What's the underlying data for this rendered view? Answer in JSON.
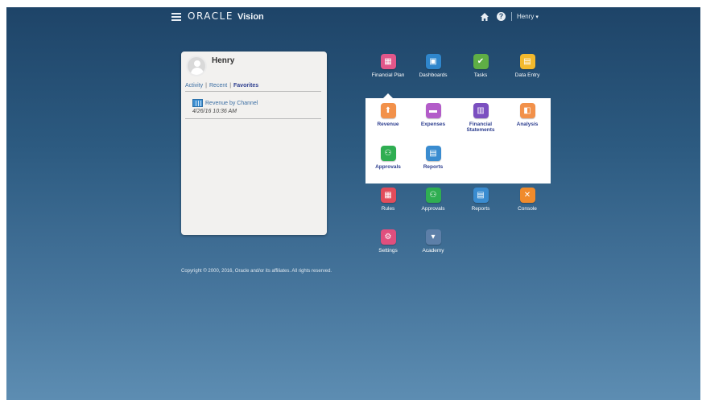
{
  "app": {
    "logo_oracle": "ORACLE",
    "logo_vision": "Vision",
    "user_menu_label": "Henry",
    "user_menu_caret": "▾",
    "help_glyph": "?"
  },
  "profile": {
    "name": "Henry",
    "tabs": [
      {
        "label": "Activity"
      },
      {
        "label": "Recent"
      },
      {
        "label": "Favorites"
      }
    ],
    "tab_separator": "|",
    "favorite": {
      "label": "Revenue by Channel",
      "date": "4/26/16 10:36 AM"
    }
  },
  "launcher": {
    "top_row": [
      {
        "label": "Financial Plan",
        "icon": "financial-plan-icon",
        "glyph": "▦",
        "color": "#e2578a"
      },
      {
        "label": "Dashboards",
        "icon": "dashboards-icon",
        "glyph": "▣",
        "color": "#2f86cc"
      },
      {
        "label": "Tasks",
        "icon": "tasks-icon",
        "glyph": "✔",
        "color": "#5fae45"
      },
      {
        "label": "Data Entry",
        "icon": "data-entry-icon",
        "glyph": "▤",
        "color": "#f3b92d"
      }
    ],
    "panel_row1": [
      {
        "label": "Revenue",
        "icon": "revenue-icon",
        "glyph": "⬆",
        "color": "#f2914a"
      },
      {
        "label": "Expenses",
        "icon": "expenses-icon",
        "glyph": "▬",
        "color": "#b35cc9"
      },
      {
        "label": "Financial\nStatements",
        "icon": "financial-statements-icon",
        "glyph": "▥",
        "color": "#7b4fc0"
      },
      {
        "label": "Analysis",
        "icon": "analysis-icon",
        "glyph": "◧",
        "color": "#f2914a"
      }
    ],
    "panel_row2": [
      {
        "label": "Approvals",
        "icon": "approvals-icon",
        "glyph": "⚇",
        "color": "#2fae52"
      },
      {
        "label": "Reports",
        "icon": "reports-icon",
        "glyph": "▤",
        "color": "#3a8cd0"
      }
    ],
    "middle_row": [
      {
        "label": "Rules",
        "icon": "rules-icon",
        "glyph": "▦",
        "color": "#e24d5b"
      },
      {
        "label": "Approvals",
        "icon": "approvals-icon",
        "glyph": "⚇",
        "color": "#2fae52"
      },
      {
        "label": "Reports",
        "icon": "reports-icon",
        "glyph": "▤",
        "color": "#3a8cd0"
      },
      {
        "label": "Console",
        "icon": "console-icon",
        "glyph": "✕",
        "color": "#f08b2c"
      }
    ],
    "bottom_row": [
      {
        "label": "Settings",
        "icon": "settings-icon",
        "glyph": "⚙",
        "color": "#e04f7e"
      },
      {
        "label": "Academy",
        "icon": "academy-icon",
        "glyph": "▾",
        "color": "#5d7fa8"
      }
    ]
  },
  "footer": {
    "copyright": "Copyright © 2000, 2016, Oracle and/or its affiliates. All rights reserved."
  }
}
